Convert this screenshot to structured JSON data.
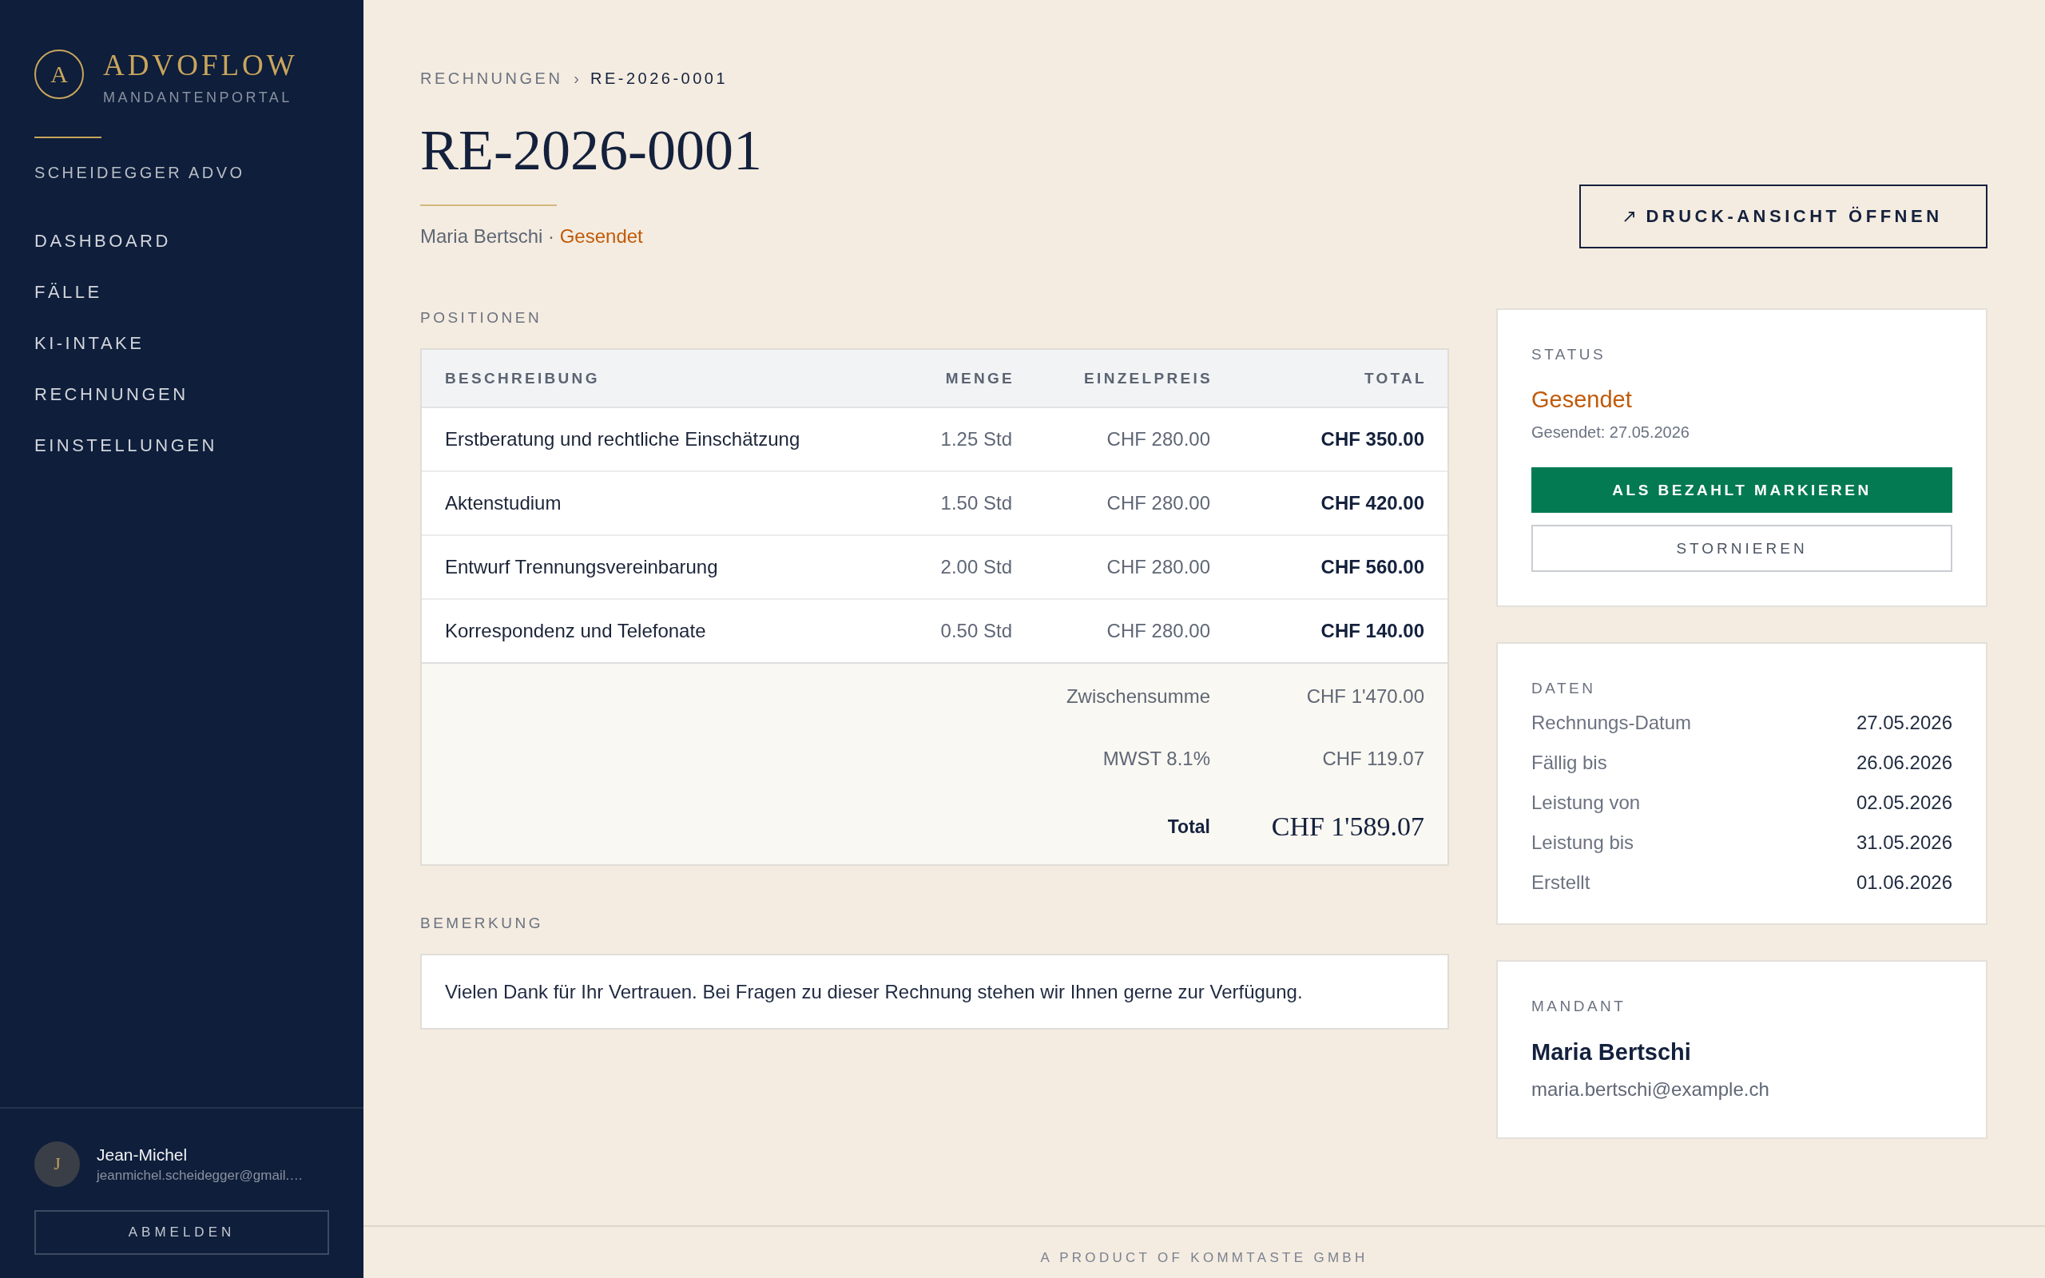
{
  "sidebar": {
    "brand": {
      "initial": "A",
      "name": "ADVOFLOW",
      "tagline": "MANDANTENPORTAL"
    },
    "firm": "SCHEIDEGGER ADVO",
    "nav": [
      {
        "label": "DASHBOARD",
        "selected": false
      },
      {
        "label": "FÄLLE",
        "selected": false
      },
      {
        "label": "KI-INTAKE",
        "selected": false
      },
      {
        "label": "RECHNUNGEN",
        "selected": false
      },
      {
        "label": "EINSTELLUNGEN",
        "selected": false
      }
    ],
    "user": {
      "initial": "J",
      "name": "Jean-Michel",
      "email": "jeanmichel.scheidegger@gmail.…"
    },
    "logout_button": "ABMELDEN"
  },
  "header": {
    "breadcrumb": [
      {
        "label": "RECHNUNGEN",
        "current": false
      },
      {
        "label": "RE-2026-0001",
        "current": true
      }
    ],
    "breadcrumb_separator": "›",
    "title": "RE-2026-0001",
    "client": "Maria Bertschi",
    "subtitle_separator": "·",
    "status": "Gesendet",
    "print_button": "DRUCK-ANSICHT ÖFFNEN"
  },
  "positions": {
    "heading": "POSITIONEN",
    "columns": [
      "BESCHREIBUNG",
      "MENGE",
      "EINZELPREIS",
      "TOTAL"
    ],
    "rows": [
      {
        "description": "Erstberatung und rechtliche Einschätzung",
        "quantity": "1.25 Std",
        "unit_price": "CHF 280.00",
        "total": "CHF 350.00"
      },
      {
        "description": "Aktenstudium",
        "quantity": "1.50 Std",
        "unit_price": "CHF 280.00",
        "total": "CHF 420.00"
      },
      {
        "description": "Entwurf Trennungsvereinbarung",
        "quantity": "2.00 Std",
        "unit_price": "CHF 280.00",
        "total": "CHF 560.00"
      },
      {
        "description": "Korrespondenz und Telefonate",
        "quantity": "0.50 Std",
        "unit_price": "CHF 280.00",
        "total": "CHF 140.00"
      }
    ],
    "summary": [
      {
        "kind": "line",
        "label": "Zwischensumme",
        "value": "CHF 1'470.00"
      },
      {
        "kind": "line",
        "label": "MWST 8.1%",
        "value": "CHF 119.07"
      },
      {
        "kind": "total",
        "label": "Total",
        "value": "CHF 1'589.07"
      }
    ]
  },
  "remark": {
    "heading": "BEMERKUNG",
    "text": "Vielen Dank für Ihr Vertrauen. Bei Fragen zu dieser Rechnung stehen wir Ihnen gerne zur Verfügung."
  },
  "status_card": {
    "heading": "STATUS",
    "status": "Gesendet",
    "sent_date": "Gesendet: 27.05.2026",
    "buttons": [
      {
        "kind": "primary",
        "label": "ALS BEZAHLT MARKIEREN"
      },
      {
        "kind": "secondary",
        "label": "STORNIEREN"
      }
    ]
  },
  "dates_card": {
    "heading": "DATEN",
    "rows": [
      {
        "label": "Rechnungs-Datum",
        "value": "27.05.2026"
      },
      {
        "label": "Fällig bis",
        "value": "26.06.2026"
      },
      {
        "label": "Leistung von",
        "value": "02.05.2026"
      },
      {
        "label": "Leistung bis",
        "value": "31.05.2026"
      },
      {
        "label": "Erstellt",
        "value": "01.06.2026"
      }
    ]
  },
  "client_card": {
    "heading": "MANDANT",
    "name": "Maria Bertschi",
    "email": "maria.bertschi@example.ch"
  },
  "footer": "A PRODUCT OF KOMMTASTE GMBH"
}
